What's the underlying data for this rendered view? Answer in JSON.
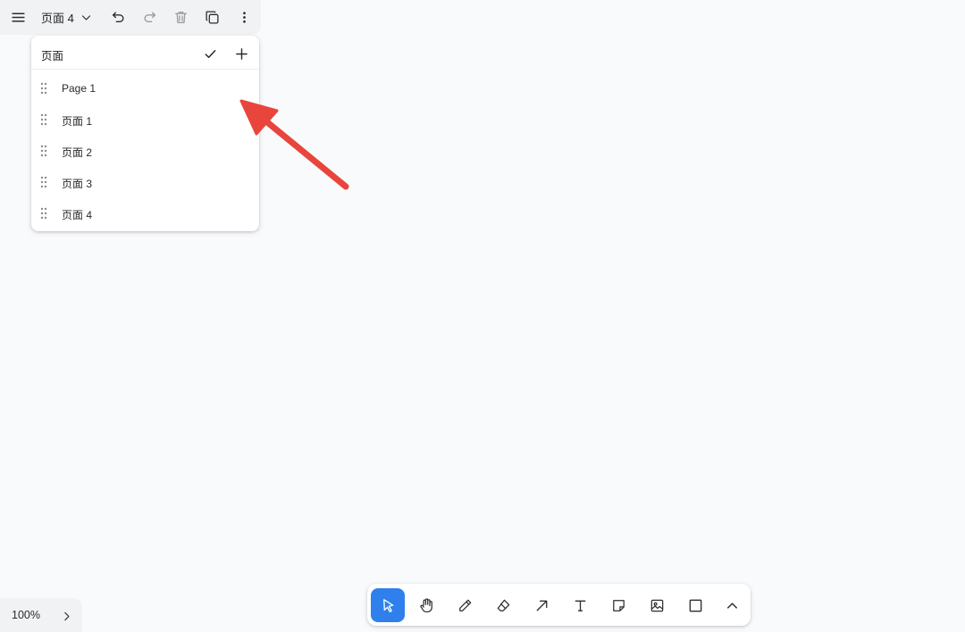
{
  "topbar": {
    "current_page": "页面 4",
    "icons": [
      "menu-icon",
      "chevron-down-icon",
      "undo-icon",
      "redo-icon",
      "trash-icon",
      "duplicate-icon",
      "more-vertical-icon"
    ]
  },
  "pages_menu": {
    "title": "页面",
    "confirm_icon": "check-icon",
    "add_icon": "plus-icon",
    "items": [
      {
        "label": "Page 1"
      },
      {
        "label": "页面 1"
      },
      {
        "label": "页面 2"
      },
      {
        "label": "页面 3"
      },
      {
        "label": "页面 4"
      }
    ]
  },
  "annotation": {
    "color": "#e8453c"
  },
  "toolbar": {
    "accent": "#2f80ed",
    "tools": [
      "select-icon",
      "hand-icon",
      "pencil-icon",
      "eraser-icon",
      "arrow-icon",
      "text-icon",
      "note-icon",
      "image-icon",
      "rectangle-icon",
      "chevron-up-icon"
    ],
    "active_tool": "select-icon"
  },
  "zoom": {
    "value": "100%"
  }
}
